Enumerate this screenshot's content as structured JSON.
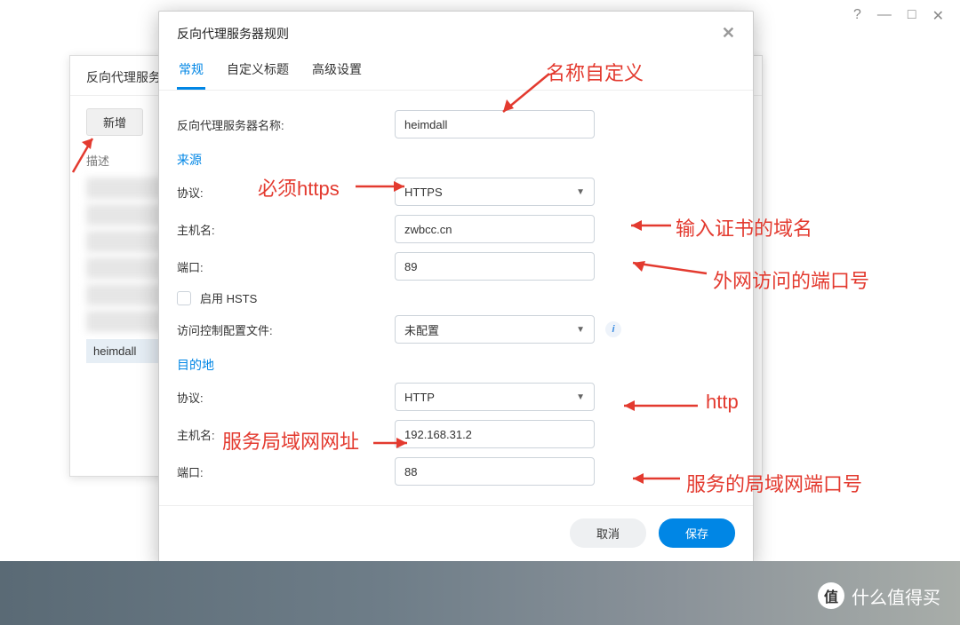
{
  "titlebar": {
    "help": "?",
    "min": "—",
    "max": "□",
    "close": "✕"
  },
  "back": {
    "title": "反向代理服务器",
    "add": "新增",
    "desc": "描述",
    "selected": "heimdall"
  },
  "dialog": {
    "title": "反向代理服务器规则",
    "close": "✕",
    "tabs": {
      "general": "常规",
      "custom": "自定义标题",
      "advanced": "高级设置"
    },
    "labels": {
      "name": "反向代理服务器名称:",
      "source": "来源",
      "protocol": "协议:",
      "host": "主机名:",
      "port": "端口:",
      "hsts": "启用 HSTS",
      "acl": "访问控制配置文件:",
      "dest": "目的地"
    },
    "values": {
      "name": "heimdall",
      "src_proto": "HTTPS",
      "src_host": "zwbcc.cn",
      "src_port": "89",
      "acl": "未配置",
      "dst_proto": "HTTP",
      "dst_host": "192.168.31.2",
      "dst_port": "88"
    },
    "buttons": {
      "cancel": "取消",
      "save": "保存"
    }
  },
  "annotations": {
    "a1": "名称自定义",
    "a2": "必须https",
    "a3": "输入证书的域名",
    "a4": "外网访问的端口号",
    "a5": "http",
    "a6": "服务局域网网址",
    "a7": "服务的局域网端口号"
  },
  "watermark": {
    "icon": "值",
    "text": "什么值得买"
  }
}
